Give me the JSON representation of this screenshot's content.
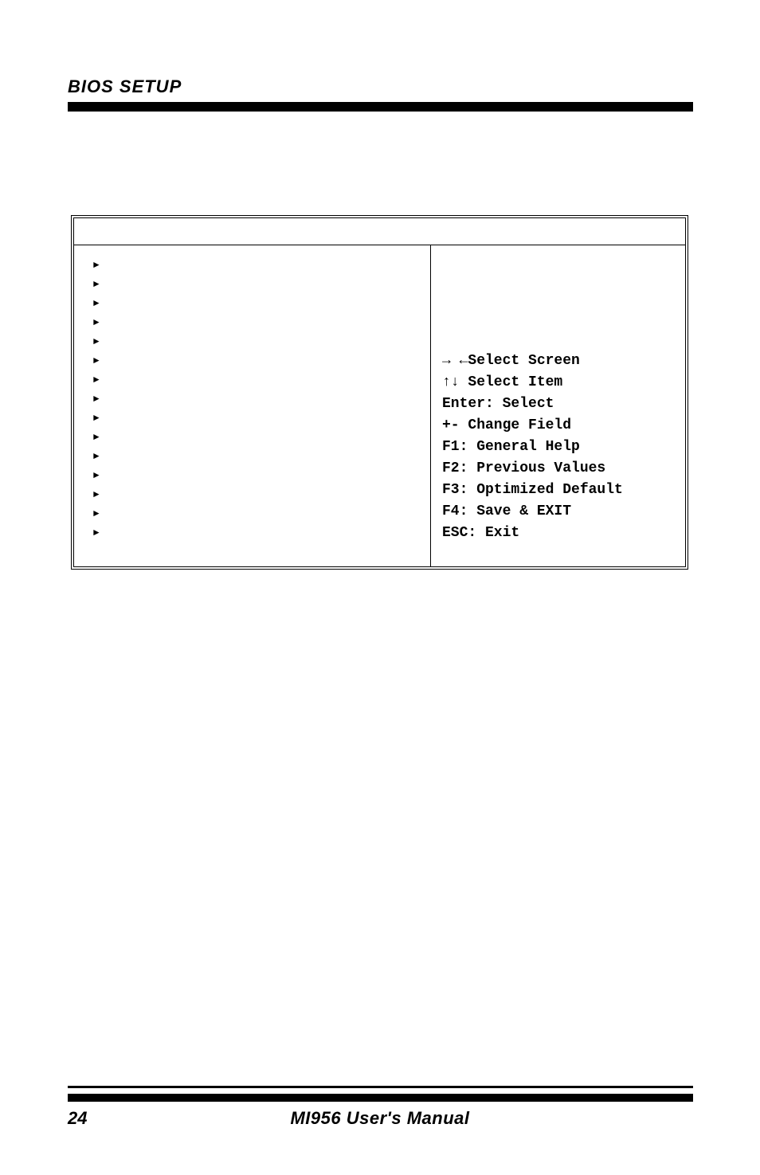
{
  "header": {
    "title": "BIOS SETUP"
  },
  "bios": {
    "help": {
      "select_screen": "→ ←Select Screen",
      "select_item": "↑↓ Select Item",
      "enter": "Enter: Select",
      "change_field": "+-  Change Field",
      "f1": "F1: General Help",
      "f2": "F2: Previous Values",
      "f3": "F3: Optimized Default",
      "f4": "F4: Save & EXIT",
      "esc": "ESC: Exit"
    }
  },
  "footer": {
    "page": "24",
    "manual": "MI956 User's Manual"
  }
}
